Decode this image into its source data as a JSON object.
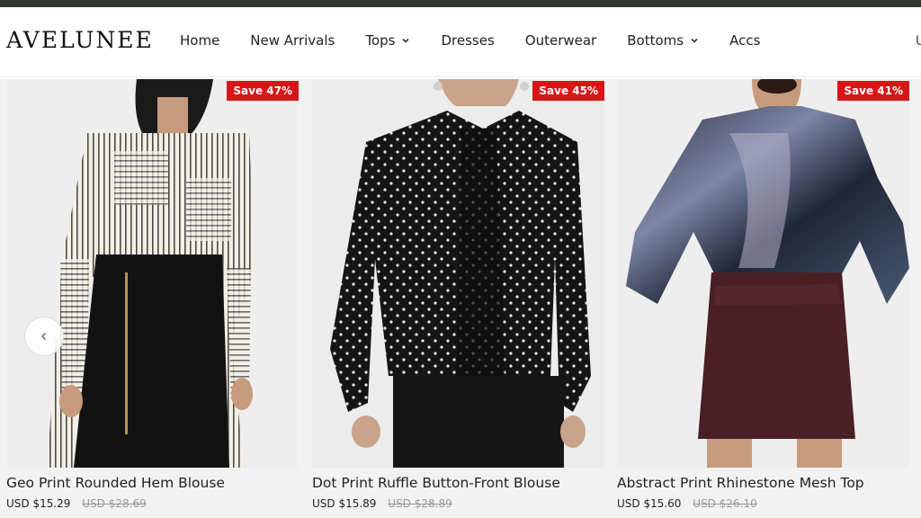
{
  "brand": "AVELUNEE",
  "nav": {
    "items": [
      {
        "label": "Home",
        "dropdown": false
      },
      {
        "label": "New Arrivals",
        "dropdown": false
      },
      {
        "label": "Tops",
        "dropdown": true
      },
      {
        "label": "Dresses",
        "dropdown": false
      },
      {
        "label": "Outerwear",
        "dropdown": false
      },
      {
        "label": "Bottoms",
        "dropdown": true
      },
      {
        "label": "Accs",
        "dropdown": false
      }
    ],
    "edge_fragment": "U"
  },
  "colors": {
    "topbar": "#2e3a2d",
    "badge": "#d81616"
  },
  "products": [
    {
      "badge": "Save 47%",
      "title": "Geo Print Rounded Hem Blouse",
      "price": "USD $15.29",
      "compare_price": "USD $28.69"
    },
    {
      "badge": "Save 45%",
      "title": "Dot Print Ruffle Button-Front Blouse",
      "price": "USD $15.89",
      "compare_price": "USD $28.89"
    },
    {
      "badge": "Save 41%",
      "title": "Abstract Print Rhinestone Mesh Top",
      "price": "USD $15.60",
      "compare_price": "USD $26.10"
    }
  ],
  "carousel": {
    "prev_icon": "chevron-left-icon"
  }
}
